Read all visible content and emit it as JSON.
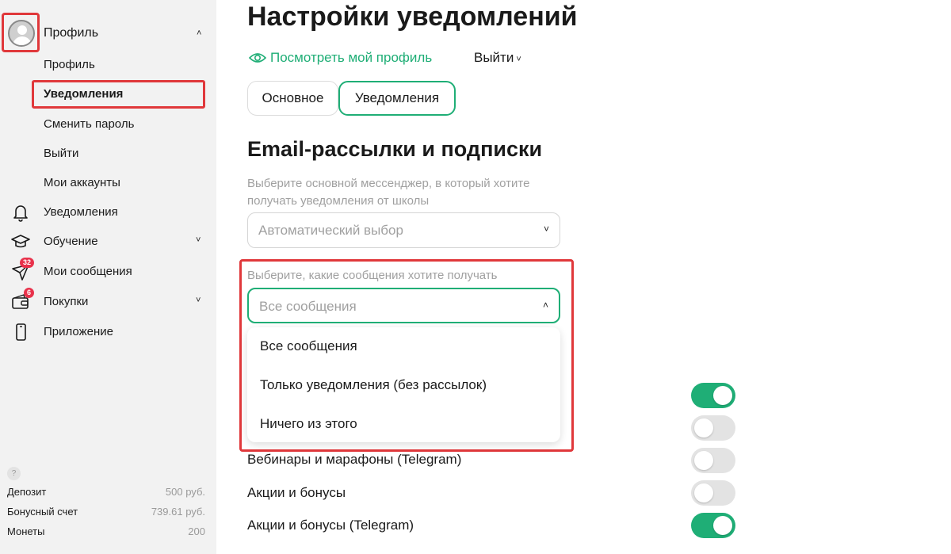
{
  "sidebar": {
    "profile_label": "Профиль",
    "sub_items": [
      "Профиль",
      "Уведомления",
      "Сменить пароль",
      "Выйти",
      "Мои аккаунты"
    ],
    "nav": [
      {
        "label": "Уведомления",
        "icon": "bell-icon"
      },
      {
        "label": "Обучение",
        "icon": "graduation-cap-icon"
      },
      {
        "label": "Мои сообщения",
        "icon": "paper-plane-icon",
        "badge": "32"
      },
      {
        "label": "Покупки",
        "icon": "wallet-icon",
        "badge": "6"
      },
      {
        "label": "Приложение",
        "icon": "smartphone-icon"
      }
    ],
    "help": "?",
    "balances": [
      {
        "label": "Депозит",
        "value": "500 руб."
      },
      {
        "label": "Бонусный счет",
        "value": "739.61 руб."
      },
      {
        "label": "Монеты",
        "value": "200"
      }
    ]
  },
  "main": {
    "title": "Настройки уведомлений",
    "view_profile": "Посмотреть мой профиль",
    "logout": "Выйти",
    "tabs": [
      "Основное",
      "Уведомления"
    ],
    "section_title": "Email-рассылки и подписки",
    "messenger_hint": "Выберите основной мессенджер, в который хотите получать уведомления от школы",
    "messenger_value": "Автоматический выбор",
    "messages_hint": "Выберите, какие сообщения хотите получать",
    "messages_value": "Все сообщения",
    "dropdown_options": [
      "Все сообщения",
      "Только уведомления (без рассылок)",
      "Ничего из этого"
    ],
    "toggles": [
      {
        "label": "",
        "on": true
      },
      {
        "label": "",
        "on": false
      },
      {
        "label": "Вебинары и марафоны (Telegram)",
        "on": false
      },
      {
        "label": "Акции и бонусы",
        "on": false
      },
      {
        "label": "Акции и бонусы (Telegram)",
        "on": true
      }
    ]
  },
  "colors": {
    "accent": "#1fae76",
    "highlight": "#e0383b",
    "badge": "#e8324b",
    "sidebar_bg": "#f2f2f2"
  }
}
